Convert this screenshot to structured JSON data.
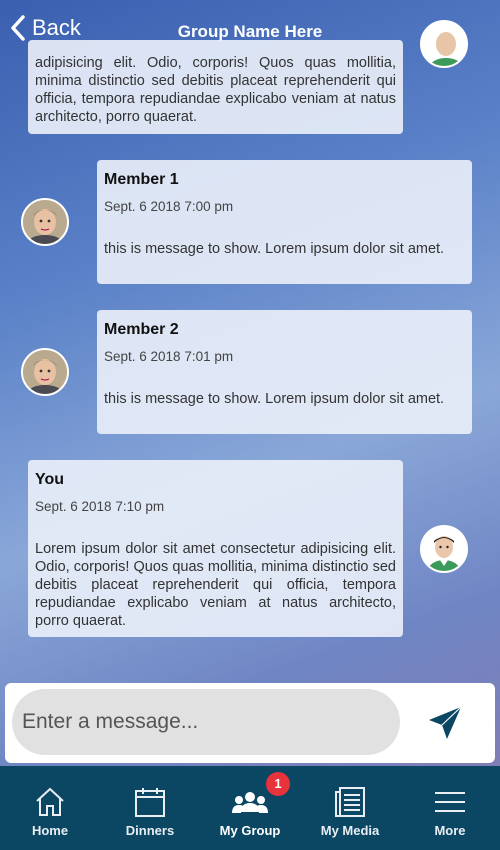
{
  "header": {
    "back_label": "Back",
    "title": "Group Name Here"
  },
  "messages": [
    {
      "sender": "",
      "time": "",
      "text": "adipisicing elit. Odio, corporis! Quos quas mollitia, minima distinctio sed debitis placeat reprehenderit qui officia, tempora repudiandae explicabo veniam at natus architecto, porro quaerat."
    },
    {
      "sender": "Member 1",
      "time": "Sept. 6 2018 7:00 pm",
      "text": "this is message to show. Lorem ipsum dolor sit amet."
    },
    {
      "sender": "Member 2",
      "time": "Sept. 6 2018 7:01 pm",
      "text": "this is message to show. Lorem ipsum dolor sit amet."
    },
    {
      "sender": "You",
      "time": "Sept. 6 2018 7:10 pm",
      "text": "Lorem ipsum dolor sit amet consectetur adipisicing elit. Odio, corporis! Quos quas mollitia, minima distinctio sed debitis placeat reprehenderit qui officia, tempora repudiandae explicabo veniam at natus architecto, porro quaerat."
    }
  ],
  "composer": {
    "placeholder": "Enter a message..."
  },
  "tabs": [
    {
      "label": "Home",
      "icon": "home-icon"
    },
    {
      "label": "Dinners",
      "icon": "calendar-icon"
    },
    {
      "label": "My Group",
      "icon": "group-icon",
      "badge": "1"
    },
    {
      "label": "My Media",
      "icon": "media-icon"
    },
    {
      "label": "More",
      "icon": "menu-icon"
    }
  ],
  "colors": {
    "tabbar": "#0b4663",
    "badge": "#e8323c",
    "send": "#0b4663"
  }
}
